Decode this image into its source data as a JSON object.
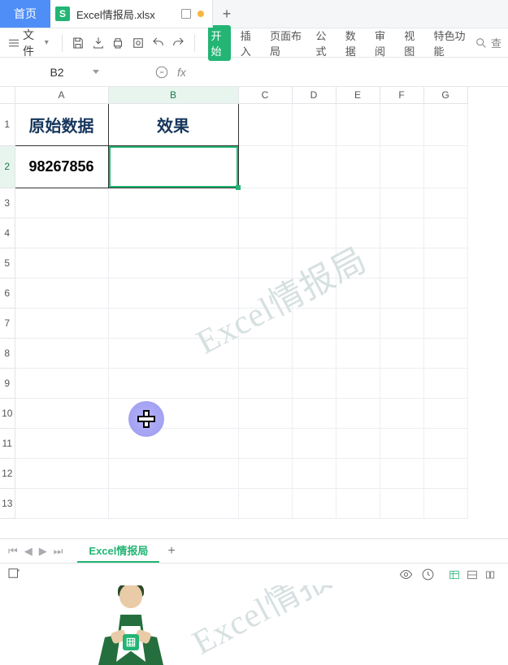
{
  "tabs": {
    "home": "首页",
    "document_title": "Excel情报局.xlsx",
    "doc_icon_letter": "S"
  },
  "quick": {
    "file_label": "文件"
  },
  "ribbon_tabs": {
    "start": "开始",
    "insert": "插入",
    "layout": "页面布局",
    "formula": "公式",
    "data": "数据",
    "review": "审阅",
    "view": "视图",
    "special": "特色功能",
    "search": "查"
  },
  "name_box": {
    "value": "B2"
  },
  "fx_label": "fx",
  "columns": [
    "A",
    "B",
    "C",
    "D",
    "E",
    "F",
    "G"
  ],
  "rows": [
    "1",
    "2",
    "3",
    "4",
    "5",
    "6",
    "7",
    "8",
    "9",
    "10",
    "11",
    "12",
    "13"
  ],
  "cells": {
    "A1": "原始数据",
    "B1": "效果",
    "A2": "98267856",
    "B2": ""
  },
  "watermark": "Excel情报局",
  "sheet_tab": {
    "name": "Excel情报局"
  },
  "column_widths": {
    "rowhead": 18,
    "A": 115,
    "B": 160,
    "C": 66,
    "D": 54,
    "E": 54,
    "F": 54,
    "G": 54
  }
}
